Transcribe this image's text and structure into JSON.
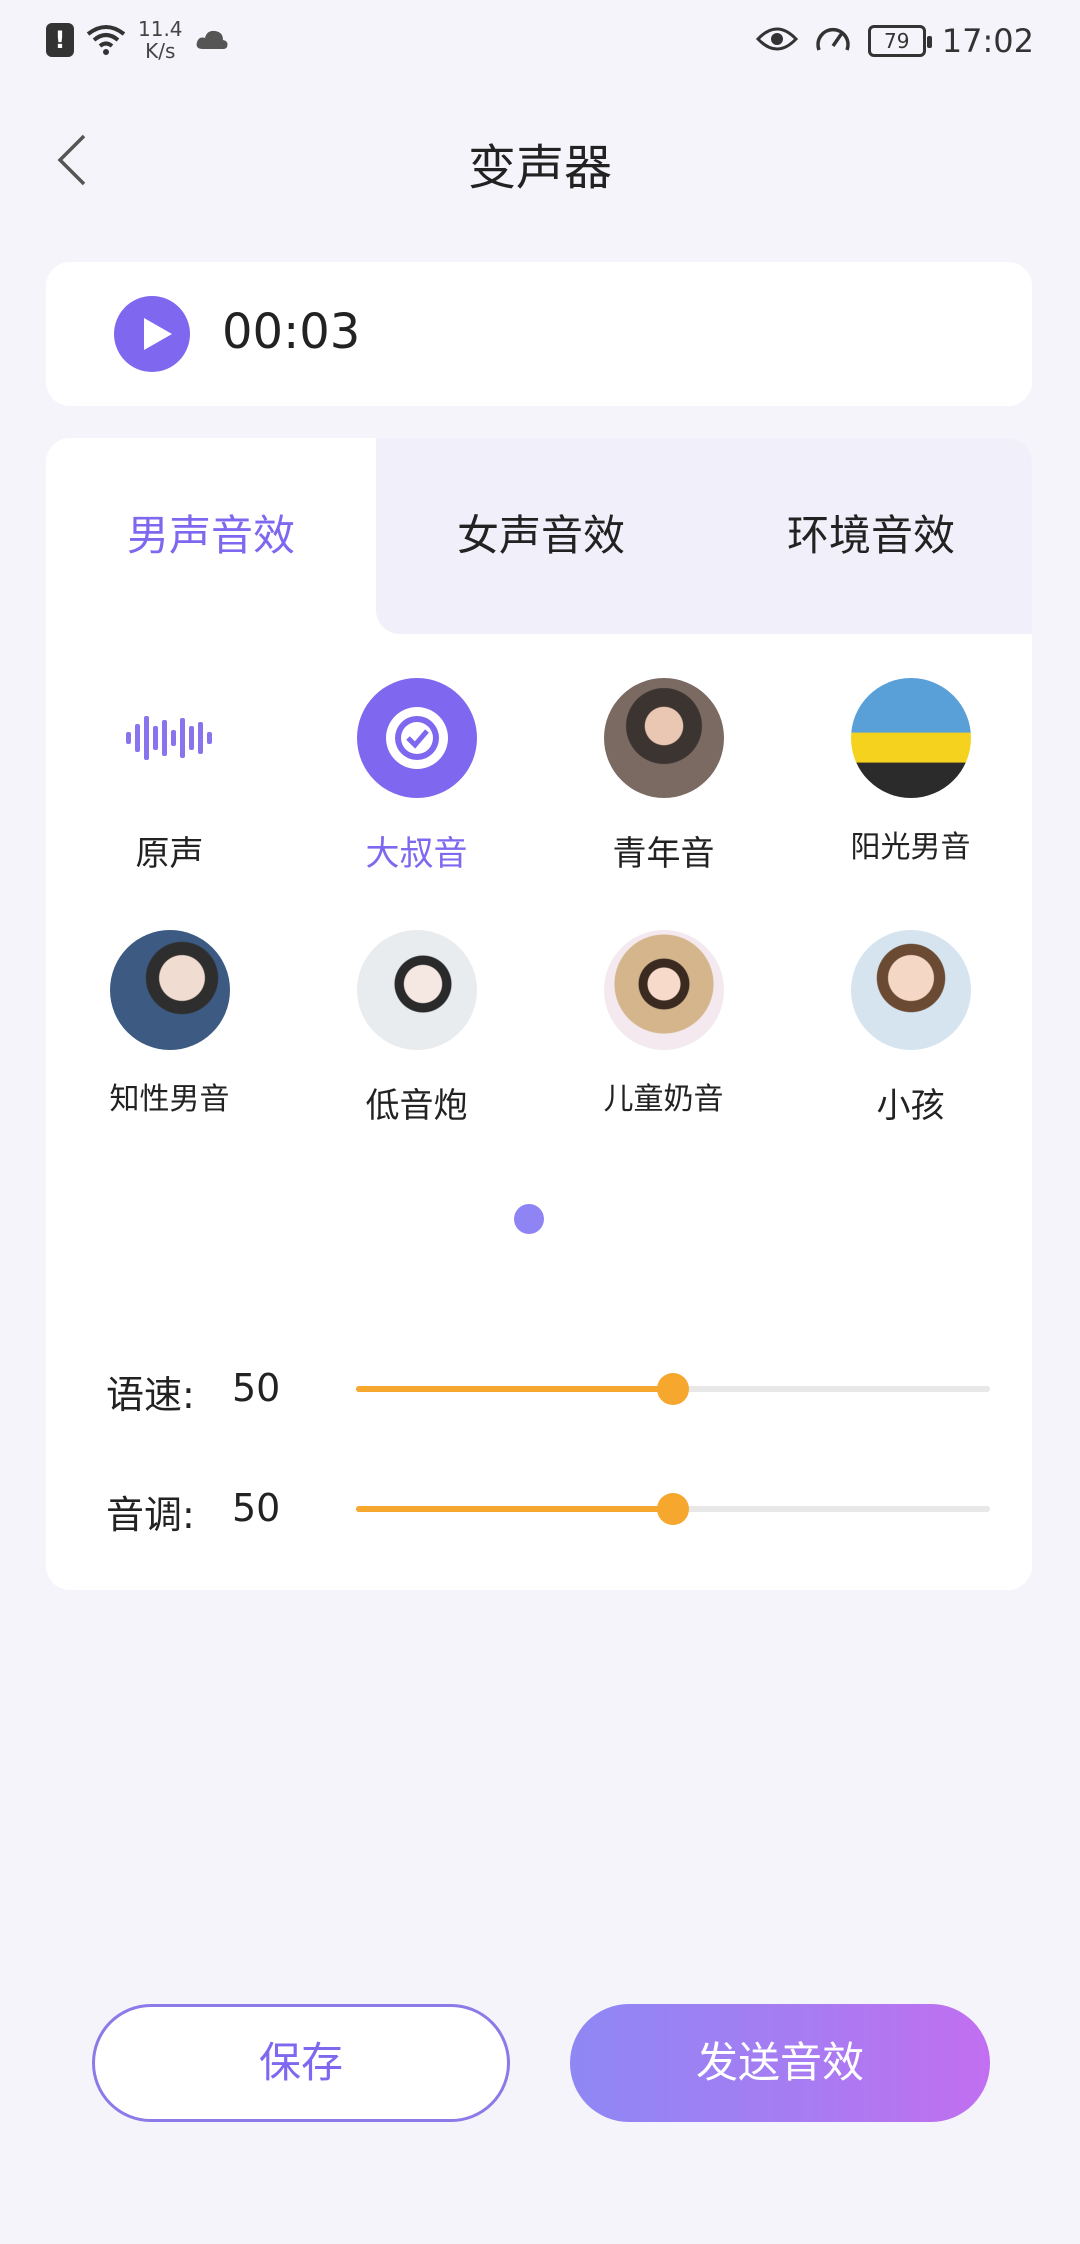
{
  "status_bar": {
    "net_speed_value": "11.4",
    "net_speed_unit": "K/s",
    "battery_level": "79",
    "time": "17:02",
    "icons": [
      "alert-icon",
      "wifi-icon",
      "cloud-icon",
      "eye-icon",
      "speed-icon",
      "battery-icon"
    ]
  },
  "header": {
    "title": "变声器",
    "back_icon": "chevron-left-icon"
  },
  "player": {
    "play_icon": "play-icon",
    "time": "00:03"
  },
  "tabs": [
    {
      "label": "男声音效",
      "active": true
    },
    {
      "label": "女声音效",
      "active": false
    },
    {
      "label": "环境音效",
      "active": false
    }
  ],
  "effects": [
    {
      "label": "原声",
      "icon": "waveform-icon",
      "selected": false
    },
    {
      "label": "大叔音",
      "icon": "check-icon",
      "selected": true
    },
    {
      "label": "青年音",
      "icon": "avatar",
      "selected": false
    },
    {
      "label": "阳光男音",
      "icon": "avatar",
      "selected": false
    },
    {
      "label": "知性男音",
      "icon": "avatar",
      "selected": false
    },
    {
      "label": "低音炮",
      "icon": "avatar",
      "selected": false
    },
    {
      "label": "儿童奶音",
      "icon": "avatar",
      "selected": false
    },
    {
      "label": "小孩",
      "icon": "avatar",
      "selected": false
    }
  ],
  "sliders": [
    {
      "label": "语速:",
      "value": "50",
      "level": 0.5
    },
    {
      "label": "音调:",
      "value": "50",
      "level": 0.5
    }
  ],
  "actions": {
    "save_label": "保存",
    "send_label": "发送音效"
  },
  "colors": {
    "accent": "#7f68ef",
    "slider": "#f6a72e",
    "background": "#f6f4fb"
  }
}
